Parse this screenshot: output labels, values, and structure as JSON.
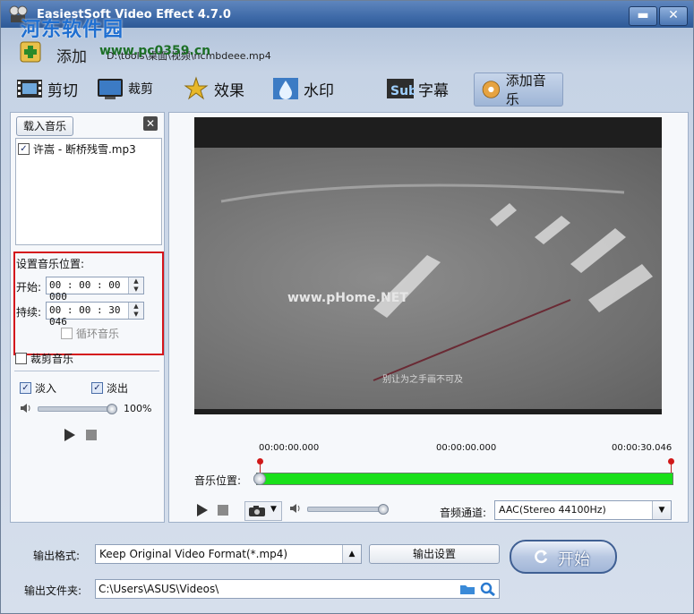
{
  "window": {
    "title": "EasiestSoft Video Effect 4.7.0",
    "minimize": "▬",
    "close": "✕"
  },
  "watermark": {
    "brand": "河东软件园",
    "url": "www.pc0359.cn"
  },
  "add": {
    "label": "添加",
    "file_path": "D:\\tools\\桌面\\视频\\ncmbdeee.mp4"
  },
  "tabs": [
    {
      "label": "剪切",
      "icon": "film-icon"
    },
    {
      "label": "裁剪",
      "icon": "monitor-icon"
    },
    {
      "label": "效果",
      "icon": "sparkle-icon"
    },
    {
      "label": "水印",
      "icon": "water-drop-icon"
    },
    {
      "label": "字幕",
      "icon": "subtitle-icon",
      "icon_text": "Sub"
    },
    {
      "label": "添加音乐",
      "icon": "music-disc-icon",
      "active": true
    }
  ],
  "left": {
    "load_music": "载入音乐",
    "close": "✕",
    "music_items": [
      {
        "name": "许嵩 - 断桥残雪.mp3",
        "checked": true
      }
    ],
    "position_title": "设置音乐位置:",
    "start_label": "开始:",
    "start_value": "00 : 00 : 00 . 000",
    "duration_label": "持续:",
    "duration_value": "00 : 00 : 30 . 046",
    "loop_label": "循环音乐",
    "crop_label": "裁剪音乐",
    "fade_in": "淡入",
    "fade_out": "淡出",
    "volume": "100%",
    "volume_level": 1.0
  },
  "preview": {
    "watermark": "www.pHome.NET",
    "subtitle": "别让为之手画不可及",
    "time_start": "00:00:00.000",
    "time_mid": "00:00:00.000",
    "time_end": "00:00:30.046",
    "music_pos_label": "音乐位置:",
    "audio_channel_label": "音频通道:",
    "audio_channel_value": "AAC(Stereo 44100Hz)",
    "volume_level": 0.95
  },
  "bottom": {
    "output_format_label": "输出格式:",
    "output_format_value": "Keep Original Video Format(*.mp4)",
    "output_settings": "输出设置",
    "output_folder_label": "输出文件夹:",
    "output_folder_value": "C:\\Users\\ASUS\\Videos\\",
    "start": "开始"
  }
}
